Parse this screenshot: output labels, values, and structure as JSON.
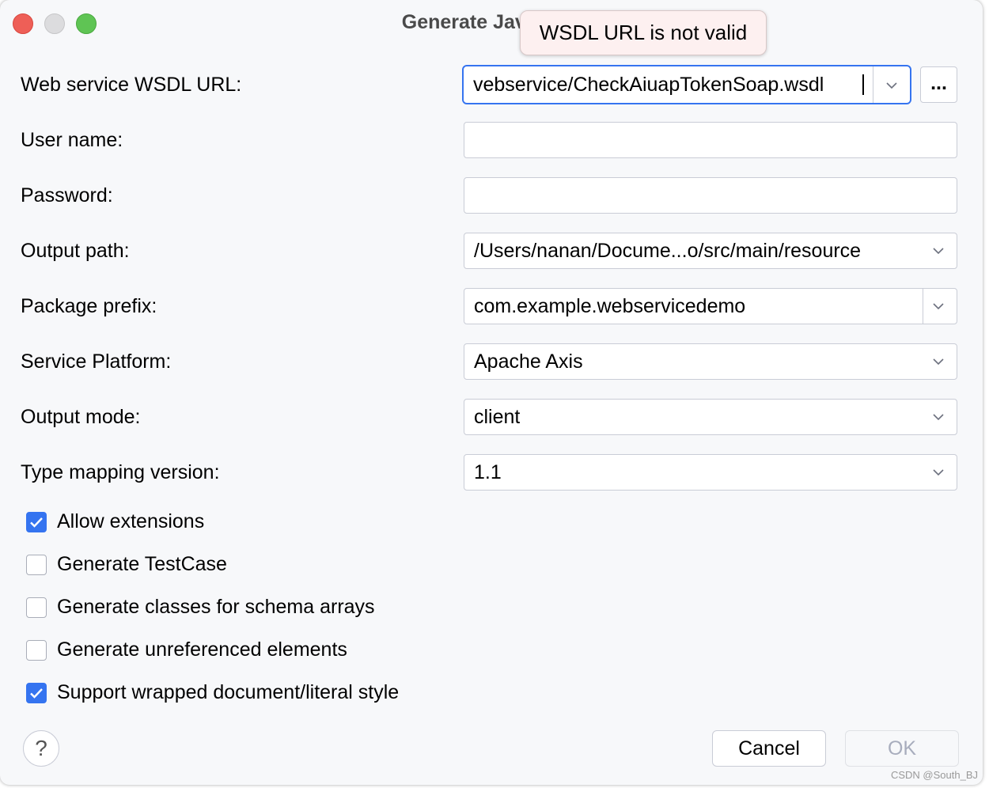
{
  "window": {
    "title": "Generate Java Code from WSDL"
  },
  "title_visible": "Generate Java Cod",
  "tooltip": "WSDL URL is not valid",
  "form": {
    "wsdl_url": {
      "label": "Web service WSDL URL:",
      "value": "vebservice/CheckAiuapTokenSoap.wsdl",
      "browse": "..."
    },
    "user_name": {
      "label": "User name:",
      "value": ""
    },
    "password": {
      "label": "Password:",
      "value": ""
    },
    "output_path": {
      "label": "Output path:",
      "value": "/Users/nanan/Docume...o/src/main/resource"
    },
    "package_prefix": {
      "label": "Package prefix:",
      "value": "com.example.webservicedemo"
    },
    "service_platform": {
      "label": "Service Platform:",
      "value": "Apache Axis"
    },
    "output_mode": {
      "label": "Output mode:",
      "value": "client"
    },
    "type_mapping": {
      "label": "Type mapping version:",
      "value": "1.1"
    }
  },
  "checkboxes": [
    {
      "label": "Allow extensions",
      "checked": true
    },
    {
      "label": "Generate TestCase",
      "checked": false
    },
    {
      "label": "Generate classes for schema arrays",
      "checked": false
    },
    {
      "label": "Generate unreferenced elements",
      "checked": false
    },
    {
      "label": "Support wrapped document/literal style",
      "checked": true
    }
  ],
  "buttons": {
    "help": "?",
    "cancel": "Cancel",
    "ok": "OK"
  },
  "watermark": "CSDN @South_BJ",
  "colors": {
    "accent": "#3574f0",
    "close": "#ee5f57",
    "maximize": "#5fc454",
    "tooltip_bg": "#fdf0f0"
  }
}
